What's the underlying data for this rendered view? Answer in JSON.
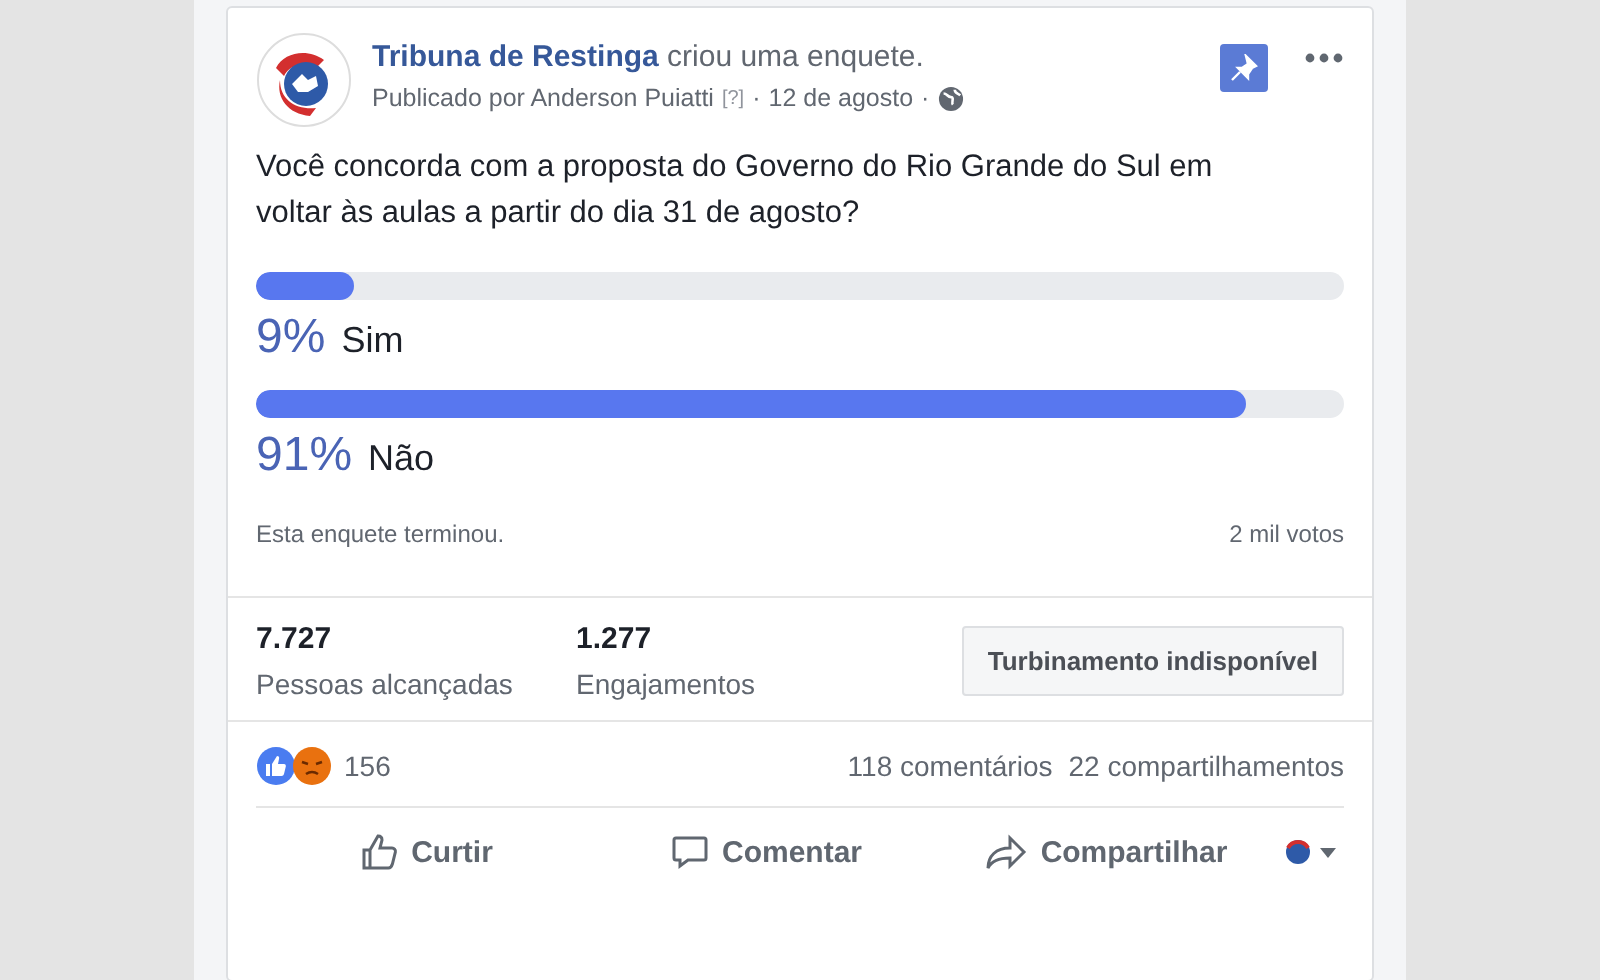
{
  "post": {
    "page_name": "Tribuna de Restinga",
    "action": "criou uma enquete.",
    "published_by": "Publicado por Anderson Puiatti",
    "help": "[?]",
    "date": "12 de agosto",
    "separator": "·",
    "pinned": true,
    "question": "Você concorda com a proposta do Governo do Rio Grande do Sul em voltar às aulas a partir do dia 31 de agosto?"
  },
  "poll": {
    "options": [
      {
        "percent": "9%",
        "label": "Sim",
        "level": 0.09
      },
      {
        "percent": "91%",
        "label": "Não",
        "level": 0.91
      }
    ],
    "status": "Esta enquete terminou.",
    "votes": "2 mil votos"
  },
  "insights": [
    {
      "value": "7.727",
      "label": "Pessoas alcançadas"
    },
    {
      "value": "1.277",
      "label": "Engajamentos"
    }
  ],
  "boost_button": {
    "label": "Turbinamento indisponível",
    "disabled": true
  },
  "reactions": {
    "count": "156",
    "comments": "118 comentários",
    "shares": "22 compartilhamentos"
  },
  "actions": [
    {
      "kind": "like",
      "label": "Curtir"
    },
    {
      "kind": "comment",
      "label": "Comentar"
    },
    {
      "kind": "share",
      "label": "Compartilhar"
    }
  ]
}
